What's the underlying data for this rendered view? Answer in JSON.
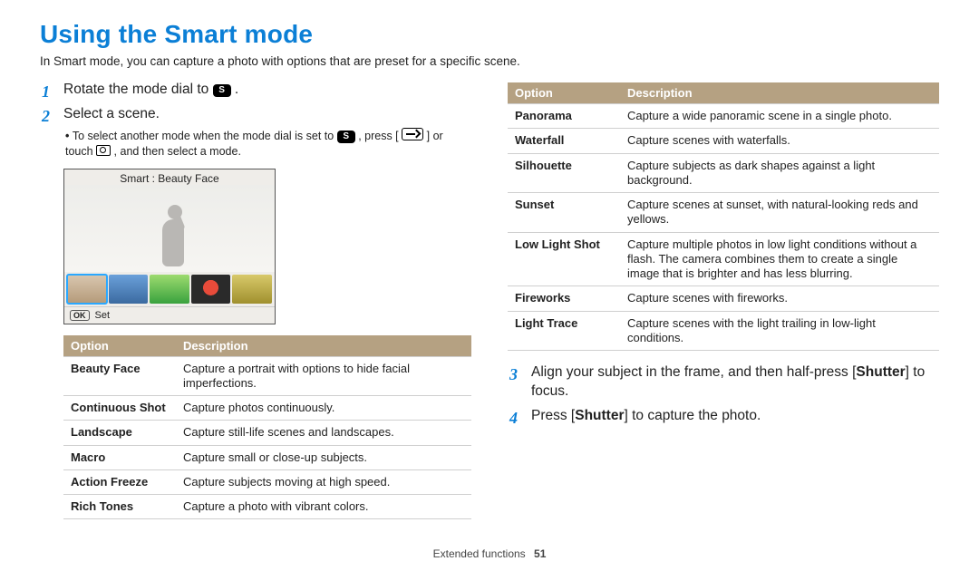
{
  "page": {
    "title": "Using the Smart mode",
    "intro": "In Smart mode, you can capture a photo with options that are preset for a specific scene."
  },
  "mode_icon_label": "S",
  "steps": {
    "s1_pre": "Rotate the mode dial to ",
    "s1_post": " .",
    "s2": "Select a scene.",
    "s2_sub_pre": "To select another mode when the mode dial is set to ",
    "s2_sub_mid1": " , press [",
    "s2_sub_mid2": "] or touch ",
    "s2_sub_post": ", and then select a mode.",
    "s3_pre": "Align your subject in the frame, and then half-press [",
    "s3_b": "Shutter",
    "s3_post": "] to focus.",
    "s4_pre": "Press [",
    "s4_b": "Shutter",
    "s4_post": "] to capture the photo."
  },
  "screenshot": {
    "title": "Smart : Beauty Face",
    "ok_label": "OK",
    "set_label": "Set"
  },
  "table_headers": {
    "option": "Option",
    "description": "Description"
  },
  "table_left": [
    {
      "name": "Beauty Face",
      "desc": "Capture a portrait with options to hide facial imperfections."
    },
    {
      "name": "Continuous Shot",
      "desc": "Capture photos continuously."
    },
    {
      "name": "Landscape",
      "desc": "Capture still-life scenes and landscapes."
    },
    {
      "name": "Macro",
      "desc": "Capture small or close-up subjects."
    },
    {
      "name": "Action Freeze",
      "desc": "Capture subjects moving at high speed."
    },
    {
      "name": "Rich Tones",
      "desc": "Capture a photo with vibrant colors."
    }
  ],
  "table_right": [
    {
      "name": "Panorama",
      "desc": "Capture a wide panoramic scene in a single photo."
    },
    {
      "name": "Waterfall",
      "desc": "Capture scenes with waterfalls."
    },
    {
      "name": "Silhouette",
      "desc": "Capture subjects as dark shapes against a light background."
    },
    {
      "name": "Sunset",
      "desc": "Capture scenes at sunset, with natural-looking reds and yellows."
    },
    {
      "name": "Low Light Shot",
      "desc": "Capture multiple photos in low light conditions without a flash. The camera combines them to create a single image that is brighter and has less blurring."
    },
    {
      "name": "Fireworks",
      "desc": "Capture scenes with fireworks."
    },
    {
      "name": "Light Trace",
      "desc": "Capture scenes with the light trailing in low-light conditions."
    }
  ],
  "footer": {
    "section": "Extended functions",
    "page_number": "51"
  }
}
